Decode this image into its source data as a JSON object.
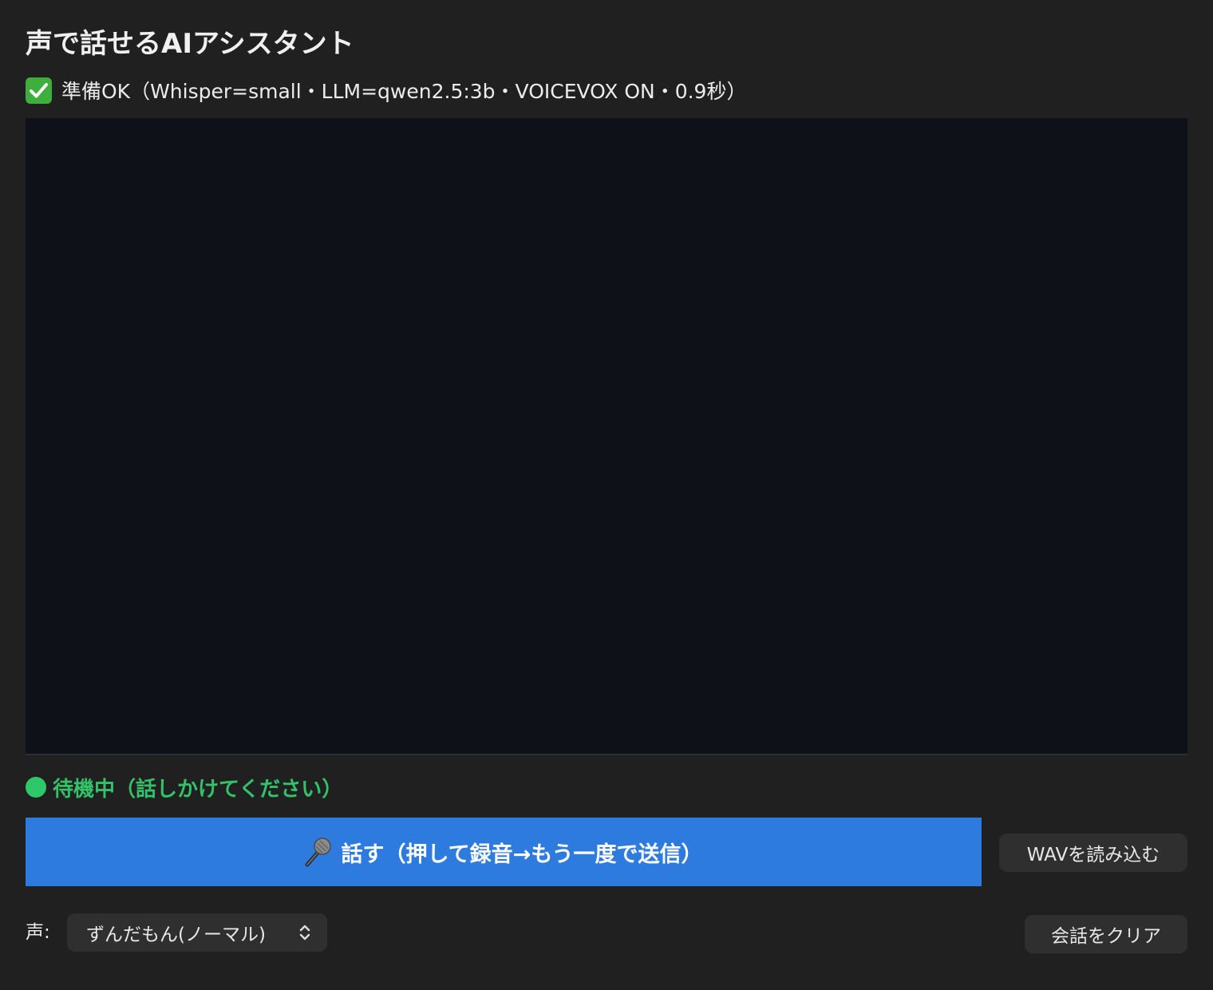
{
  "header": {
    "title": "声で話せるAIアシスタント",
    "readiness": "準備OK（Whisper=small・LLM=qwen2.5:3b・VOICEVOX ON・0.9秒）",
    "readiness_icon": "check-mark-icon"
  },
  "conversation": {
    "messages": []
  },
  "status": {
    "text": "待機中（話しかけてください）",
    "icon": "green-dot-icon",
    "color": "#33c26a"
  },
  "controls": {
    "talk_label": "話す（押して録音→もう一度で送信）",
    "talk_icon": "microphone-icon",
    "talk_color": "#2e7be0",
    "wav_label": "WAVを読み込む",
    "voice_label": "声:",
    "voice_selected": "ずんだもん(ノーマル)",
    "clear_label": "会話をクリア"
  }
}
